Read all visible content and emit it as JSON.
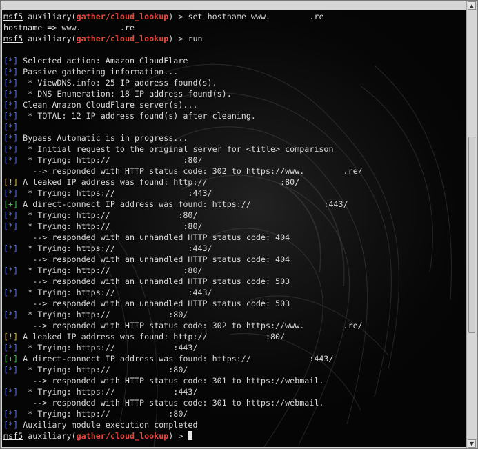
{
  "scrollbar": {
    "up_icon": "arrow-up-icon",
    "down_icon": "arrow-down-icon",
    "scroll_position": 0.53,
    "visible_fraction": 0.46
  },
  "prompt": {
    "msf": "msf5",
    "word": "auxiliary",
    "module": "gather/cloud_lookup"
  },
  "lines": [
    {
      "type": "prompt",
      "rest": " > set hostname www.        .re"
    },
    {
      "type": "plain",
      "text": "hostname => www.        .re"
    },
    {
      "type": "prompt",
      "rest": " > run"
    },
    {
      "type": "plain",
      "text": ""
    },
    {
      "type": "tag",
      "tag": "[*]",
      "cls": "info",
      "text": " Selected action: Amazon CloudFlare"
    },
    {
      "type": "tag",
      "tag": "[*]",
      "cls": "info",
      "text": " Passive gathering information..."
    },
    {
      "type": "tag",
      "tag": "[*]",
      "cls": "info",
      "text": "  * ViewDNS.info: 25 IP address found(s)."
    },
    {
      "type": "tag",
      "tag": "[*]",
      "cls": "info",
      "text": "  * DNS Enumeration: 18 IP address found(s)."
    },
    {
      "type": "tag",
      "tag": "[*]",
      "cls": "info",
      "text": " Clean Amazon CloudFlare server(s)..."
    },
    {
      "type": "tag",
      "tag": "[*]",
      "cls": "info",
      "text": "  * TOTAL: 12 IP address found(s) after cleaning."
    },
    {
      "type": "tag",
      "tag": "[*]",
      "cls": "info",
      "text": ""
    },
    {
      "type": "tag",
      "tag": "[*]",
      "cls": "info",
      "text": " Bypass Automatic is in progress..."
    },
    {
      "type": "tag",
      "tag": "[*]",
      "cls": "info",
      "text": "  * Initial request to the original server for <title> comparison"
    },
    {
      "type": "tag",
      "tag": "[*]",
      "cls": "info",
      "text": "  * Trying: http://               :80/"
    },
    {
      "type": "plain",
      "text": "      --> responded with HTTP status code: 302 to https://www.        .re/"
    },
    {
      "type": "tag",
      "tag": "[!]",
      "cls": "warn",
      "text": " A leaked IP address was found: http://               :80/"
    },
    {
      "type": "tag",
      "tag": "[*]",
      "cls": "info",
      "text": "  * Trying: https://               :443/"
    },
    {
      "type": "tag",
      "tag": "[+]",
      "cls": "good",
      "text": " A direct-connect IP address was found: https://               :443/"
    },
    {
      "type": "tag",
      "tag": "[*]",
      "cls": "info",
      "text": "  * Trying: http://              :80/"
    },
    {
      "type": "tag",
      "tag": "[*]",
      "cls": "info",
      "text": "  * Trying: http://               :80/"
    },
    {
      "type": "plain",
      "text": "      --> responded with an unhandled HTTP status code: 404"
    },
    {
      "type": "tag",
      "tag": "[*]",
      "cls": "info",
      "text": "  * Trying: https://               :443/"
    },
    {
      "type": "plain",
      "text": "      --> responded with an unhandled HTTP status code: 404"
    },
    {
      "type": "tag",
      "tag": "[*]",
      "cls": "info",
      "text": "  * Trying: http://               :80/"
    },
    {
      "type": "plain",
      "text": "      --> responded with an unhandled HTTP status code: 503"
    },
    {
      "type": "tag",
      "tag": "[*]",
      "cls": "info",
      "text": "  * Trying: https://               :443/"
    },
    {
      "type": "plain",
      "text": "      --> responded with an unhandled HTTP status code: 503"
    },
    {
      "type": "tag",
      "tag": "[*]",
      "cls": "info",
      "text": "  * Trying: http://            :80/"
    },
    {
      "type": "plain",
      "text": "      --> responded with HTTP status code: 302 to https://www.        .re/"
    },
    {
      "type": "tag",
      "tag": "[!]",
      "cls": "warn",
      "text": " A leaked IP address was found: http://            :80/"
    },
    {
      "type": "tag",
      "tag": "[*]",
      "cls": "info",
      "text": "  * Trying: https://            :443/"
    },
    {
      "type": "tag",
      "tag": "[+]",
      "cls": "good",
      "text": " A direct-connect IP address was found: https://            :443/"
    },
    {
      "type": "tag",
      "tag": "[*]",
      "cls": "info",
      "text": "  * Trying: http://            :80/"
    },
    {
      "type": "plain",
      "text": "      --> responded with HTTP status code: 301 to https://webmail."
    },
    {
      "type": "tag",
      "tag": "[*]",
      "cls": "info",
      "text": "  * Trying: https://            :443/"
    },
    {
      "type": "plain",
      "text": "      --> responded with HTTP status code: 301 to https://webmail."
    },
    {
      "type": "tag",
      "tag": "[*]",
      "cls": "info",
      "text": "  * Trying: http://            :80/"
    },
    {
      "type": "tag",
      "tag": "[*]",
      "cls": "info",
      "text": " Auxiliary module execution completed"
    },
    {
      "type": "prompt",
      "rest": " > ",
      "cursor": true
    }
  ]
}
